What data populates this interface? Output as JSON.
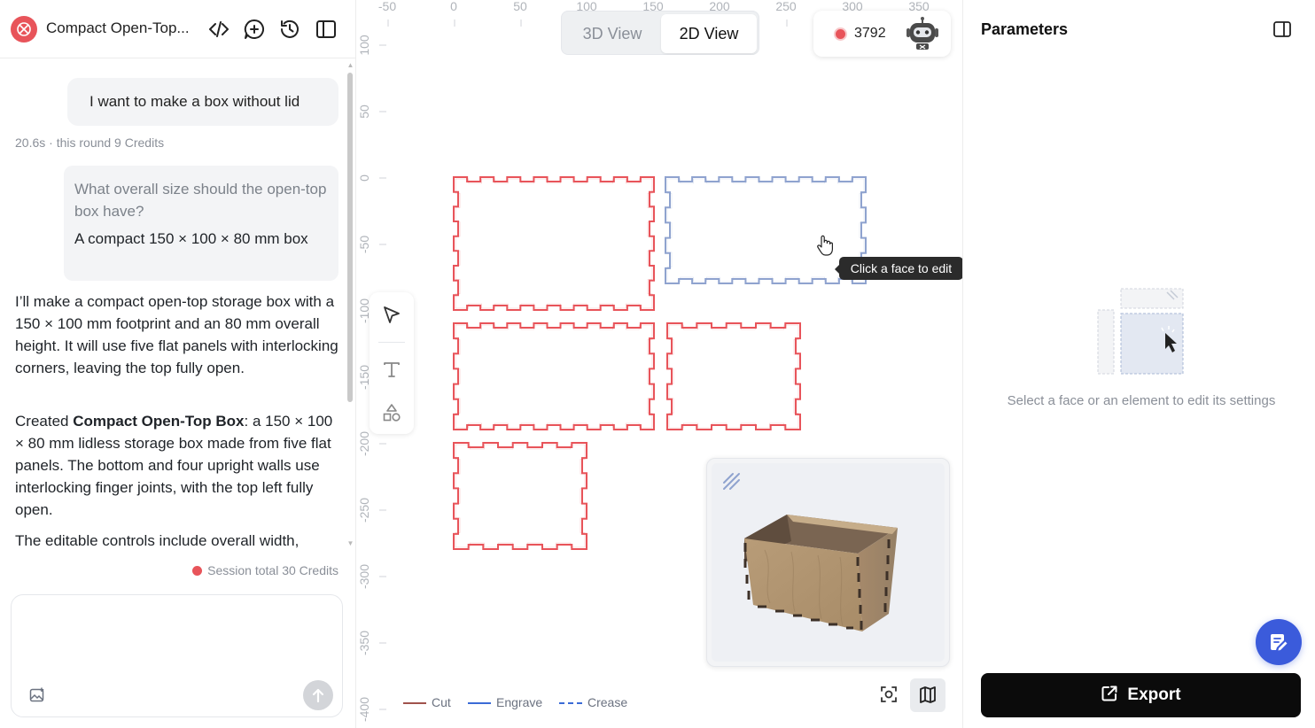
{
  "chat": {
    "title": "Compact Open-Top...",
    "user_message": "I want to make a box without lid",
    "meta": "20.6s · this round 9 Credits",
    "question": "What overall size should the open-top box have?",
    "answer": "A compact 150 × 100 × 80 mm box",
    "para1": "I’ll make a compact open-top storage box with a 150 × 100 mm footprint and an 80 mm overall height. It will use five flat panels with interlocking corners, leaving the top fully open.",
    "para2_prefix": "Created ",
    "para2_bold": "Compact Open-Top Box",
    "para2_rest": ": a 150 × 100 × 80 mm lidless storage box made from five flat panels. The bottom and four upright walls use interlocking finger joints, with the top left fully open.",
    "para3": "The editable controls include overall width,",
    "session_total": "Session total 30 Credits",
    "input_value": ""
  },
  "canvas": {
    "view_3d": "3D View",
    "view_2d": "2D View",
    "credits": "3792",
    "tooltip": "Click a face to edit",
    "ruler_x": [
      "-50",
      "0",
      "50",
      "100",
      "150",
      "200",
      "250",
      "300",
      "350"
    ],
    "ruler_y": [
      "100",
      "50",
      "0",
      "-50",
      "-100",
      "-150",
      "-200",
      "-250",
      "-300",
      "-350",
      "-400"
    ],
    "legend": [
      {
        "label": "Cut",
        "color": "#a0524c",
        "style": "solid"
      },
      {
        "label": "Engrave",
        "color": "#3b6bd6",
        "style": "solid"
      },
      {
        "label": "Crease",
        "color": "#3b6bd6",
        "style": "dashed"
      }
    ],
    "panel_colors": {
      "cut": "#e8545a",
      "selected": "#8fa3cf"
    }
  },
  "params": {
    "title": "Parameters",
    "empty_text": "Select a face or an element to edit its settings",
    "export_label": "Export"
  },
  "colors": {
    "accent": "#e8545a",
    "fab": "#3b5bdb",
    "export_bg": "#0b0b0b"
  }
}
